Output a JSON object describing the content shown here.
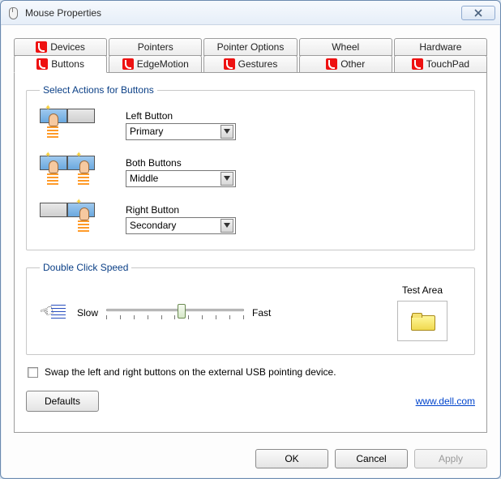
{
  "title": "Mouse Properties",
  "tabs_row1": [
    "Devices",
    "Pointers",
    "Pointer Options",
    "Wheel",
    "Hardware"
  ],
  "tabs_row2": [
    "Buttons",
    "EdgeMotion",
    "Gestures",
    "Other",
    "TouchPad"
  ],
  "active_tab": "Buttons",
  "actions_group": {
    "legend": "Select Actions for Buttons",
    "left": {
      "label": "Left Button",
      "value": "Primary"
    },
    "both": {
      "label": "Both Buttons",
      "value": "Middle"
    },
    "right": {
      "label": "Right Button",
      "value": "Secondary"
    }
  },
  "dblclick": {
    "legend": "Double Click Speed",
    "slow": "Slow",
    "fast": "Fast",
    "test_label": "Test Area"
  },
  "swap_label": "Swap the left and right buttons on the external USB pointing device.",
  "swap_checked": false,
  "defaults_label": "Defaults",
  "link_text": "www.dell.com",
  "buttons": {
    "ok": "OK",
    "cancel": "Cancel",
    "apply": "Apply"
  }
}
